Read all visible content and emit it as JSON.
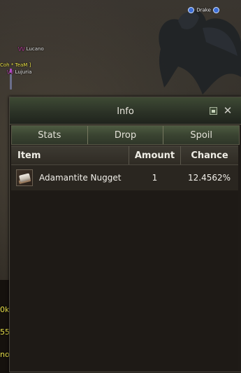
{
  "world": {
    "nameplates": {
      "drake": "Drake",
      "lucano_prefix": "\\/\\/",
      "lucano": "Lucano",
      "team": "Coh * TeaM ]",
      "lujuria_prefix": "\\/\\/",
      "lujuria": "Lujuria"
    },
    "side_texts": [
      "0k",
      "55",
      "nor"
    ]
  },
  "info_window": {
    "title": "Info",
    "tabs": [
      "Stats",
      "Drop",
      "Spoil"
    ],
    "columns": {
      "item": "Item",
      "amount": "Amount",
      "chance": "Chance"
    },
    "rows": [
      {
        "icon": "adamantite-nugget-icon",
        "name": "Adamantite Nugget",
        "amount": "1",
        "chance": "12.4562%"
      }
    ]
  }
}
